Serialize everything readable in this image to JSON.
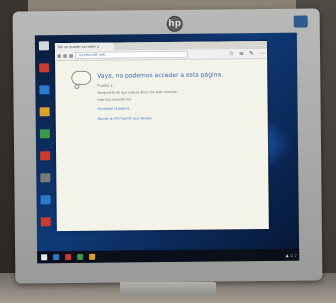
{
  "browser": {
    "tab_label": "No se puede acceder a",
    "address": "uy.emusoft.net/...",
    "error_title": "Vaya, no podemos acceder a esta página.",
    "error_subtitle": "Prueba a:",
    "error_items": [
      "Asegurarte de que usas la dirección web correcta:",
      "http://uy.emusoft.net"
    ],
    "links": [
      "Actualizar la página",
      "Buscar la información que deseas"
    ]
  },
  "monitor": {
    "logo": "hp"
  },
  "colors": {
    "accent": "#3b6bb5",
    "link": "#2e6bd0",
    "desktop": "#0f3a78"
  }
}
